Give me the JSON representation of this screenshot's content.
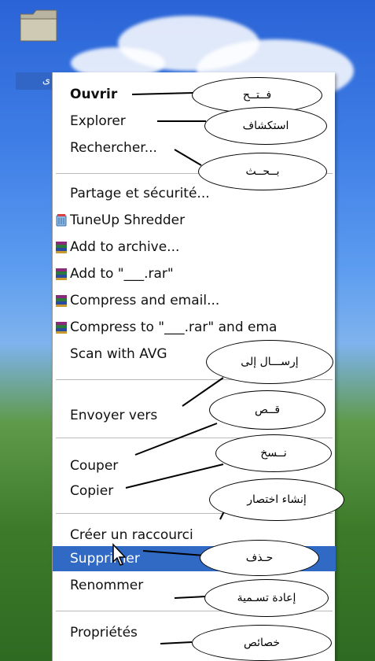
{
  "desktop": {
    "folder_label": "ى"
  },
  "menu": {
    "items": [
      {
        "label": "Ouvrir",
        "bold": true
      },
      {
        "label": "Explorer"
      },
      {
        "label": "Rechercher..."
      },
      {
        "label": "Partage et sécurité..."
      },
      {
        "label": "TuneUp Shredder",
        "icon": "tuneup-shredder-icon"
      },
      {
        "label": "Add to archive...",
        "icon": "winrar-icon"
      },
      {
        "label": "Add to \"___.rar\"",
        "icon": "winrar-icon"
      },
      {
        "label": "Compress and email...",
        "icon": "winrar-icon"
      },
      {
        "label": "Compress to \"___.rar\" and ema",
        "icon": "winrar-icon"
      },
      {
        "label": "Scan with AVG"
      },
      {
        "label": "Envoyer vers"
      },
      {
        "label": "Couper"
      },
      {
        "label": "Copier"
      },
      {
        "label": "Créer un raccourci"
      },
      {
        "label": "Supprimer",
        "selected": true
      },
      {
        "label": "Renommer"
      },
      {
        "label": "Propriétés"
      }
    ]
  },
  "annotations": {
    "open": "فــتــح",
    "explore": "استكشاف",
    "search": "بــحــث",
    "send_to": "إرســـال إلى",
    "cut": "قــص",
    "copy": "نــسخ",
    "shortcut": "إنشاء اختصار",
    "delete": "حـذف",
    "rename": "إعادة تسـمية",
    "properties": "خصائص"
  },
  "colors": {
    "selection": "#316ac5",
    "menu_bg": "#ffffff",
    "separator": "#b9b9b9"
  }
}
